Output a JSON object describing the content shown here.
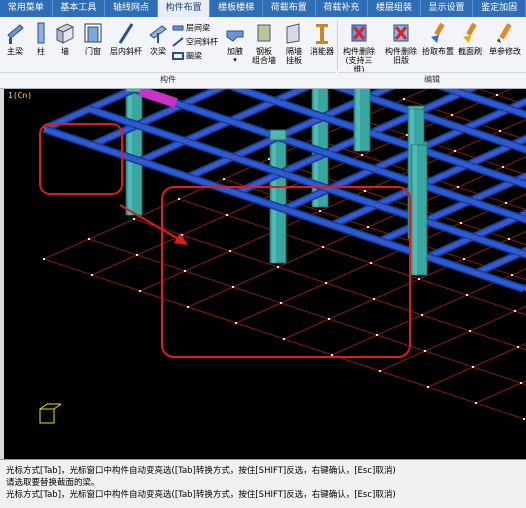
{
  "tabs": [
    "常用菜单",
    "基本工具",
    "轴线网点",
    "构件布置",
    "楼板楼梯",
    "荷载布置",
    "荷载补充",
    "楼层组装",
    "显示设置",
    "鉴定加固"
  ],
  "active_tab": 3,
  "ribbon": {
    "buttons": {
      "main_beam": "主梁",
      "column": "柱",
      "wall": "墙",
      "door_window": "门窗",
      "floor_brace": "层内斜杆",
      "secondary_beam": "次梁",
      "layer_beam": "层间梁",
      "space_brace": "空间斜杆",
      "circle_beam": "圈梁",
      "haunch": "加腋",
      "steel_plate_1": "钢板",
      "steel_plate_2": "组合墙",
      "partition_1": "隔墙",
      "partition_2": "挂板",
      "energy_1": "消能器",
      "del_member_1": "构件删除",
      "del_member_2": "(支持三维)",
      "del_member_old_1": "构件删除",
      "del_member_old_2": "旧版",
      "pick_place": "拾取布置",
      "section_query": "截面刷",
      "single_param": "单参修改"
    },
    "group_labels": [
      "构件",
      "编辑"
    ]
  },
  "viewport": {
    "axis_label": "1(Cn)"
  },
  "command": {
    "line1": "光标方式[Tab]，光标窗口中构件自动变亮选([Tab]转换方式，按住[SHIFT]反选，右键确认，[Esc]取消)",
    "line2": "请选取要替换截面的梁。",
    "line3": "光标方式[Tab]，光标窗口中构件自动变亮选([Tab]转换方式，按住[SHIFT]反选，右键确认，[Esc]取消)"
  },
  "colors": {
    "beam": "#2a5bd7",
    "column": "#3aa6a0",
    "selected_beam": "#c633c6",
    "annotation": "#e11b1b",
    "wall_panel": "#8a8f3a",
    "tab_bar": "#2f6eb6"
  }
}
